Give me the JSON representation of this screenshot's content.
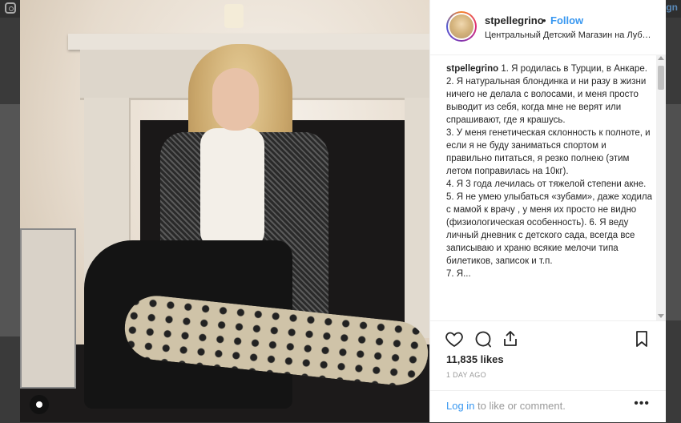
{
  "background": {
    "right_link": "gn"
  },
  "post": {
    "username": "stpellegrino",
    "separator": "•",
    "follow_label": "Follow",
    "location": "Центральный Детский Магазин на Лубя...",
    "caption_user": "stpellegrino",
    "caption_lines": [
      "1. Я родилась в Турции, в Анкаре.",
      "2. Я натуральная блондинка и ни разу в жизни ничего не делала с волосами, и меня просто выводит из себя, когда мне не верят или спрашивают, где я крашусь.",
      "3. У меня генетическая склонность к полноте, и если я не буду заниматься спортом и правильно питаться, я резко полнею (этим летом поправилась на 10кг).",
      "4. Я 3 года лечилась от тяжелой степени акне.",
      "5. Я не умею улыбаться «зубами», даже ходила с мамой к врачу , у меня их просто не видно (физиологическая особенность). 6. Я веду личный дневник с детского сада, всегда все записываю и храню всякие мелочи типа билетиков, записок и т.п.",
      "7. Я..."
    ],
    "likes": "11,835 likes",
    "timestamp": "1 DAY AGO",
    "login_link": "Log in",
    "login_rest": " to like or comment.",
    "more_label": "•••"
  },
  "icons": {
    "heart": "heart-icon",
    "comment": "comment-icon",
    "share": "share-icon",
    "bookmark": "bookmark-icon",
    "more": "more-options-icon",
    "tag": "user-tag-icon"
  },
  "colors": {
    "link": "#3897f0",
    "text": "#262626",
    "muted": "#999999"
  }
}
